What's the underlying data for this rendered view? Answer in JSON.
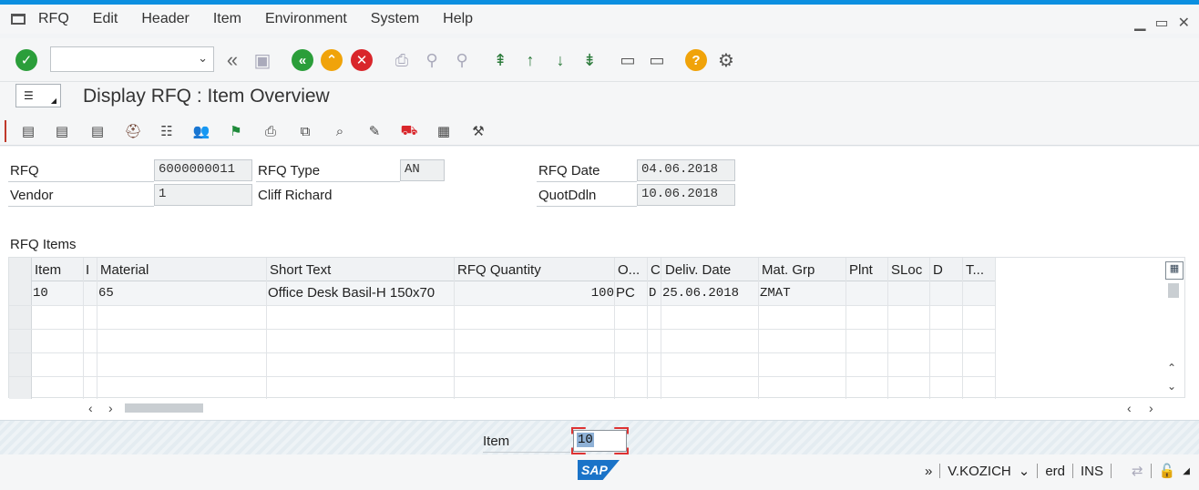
{
  "menu": {
    "items": [
      "RFQ",
      "Edit",
      "Header",
      "Item",
      "Environment",
      "System",
      "Help"
    ]
  },
  "window_controls": [
    "minimize-icon",
    "maximize-icon",
    "close-icon"
  ],
  "toolbar": {
    "command_field_value": "",
    "icons": [
      "enter-checkmark-icon",
      "back-double-chevron-icon",
      "save-icon",
      "back-icon",
      "exit-icon",
      "cancel-icon",
      "print-icon",
      "find-icon",
      "find-next-icon",
      "first-page-icon",
      "previous-page-icon",
      "next-page-icon",
      "last-page-icon",
      "create-session-icon",
      "shortcut-icon",
      "help-icon",
      "settings-gear-icon"
    ]
  },
  "title": {
    "text": "Display RFQ : Item Overview"
  },
  "app_toolbar": {
    "icons": [
      "item-details-icon",
      "header-details-icon",
      "texts-icon",
      "vendor-hat-icon",
      "structure-icon",
      "partners-icon",
      "flag-icon",
      "print-preview-icon",
      "components-icon",
      "conditions-icon",
      "additional-data-icon",
      "delivery-truck-icon",
      "schedule-calendar-icon",
      "services-icon"
    ]
  },
  "header": {
    "rfq_label": "RFQ",
    "rfq_value": "6000000011",
    "rfq_type_label": "RFQ Type",
    "rfq_type_value": "AN",
    "rfq_date_label": "RFQ Date",
    "rfq_date_value": "04.06.2018",
    "vendor_label": "Vendor",
    "vendor_value": "1",
    "vendor_name": "Cliff Richard",
    "quot_ddln_label": "QuotDdln",
    "quot_ddln_value": "10.06.2018"
  },
  "items_section": {
    "title": "RFQ Items",
    "columns": [
      "Item",
      "I",
      "Material",
      "Short Text",
      "RFQ Quantity",
      "O...",
      "C",
      "Deliv. Date",
      "Mat. Grp",
      "Plnt",
      "SLoc",
      "D",
      "T..."
    ],
    "rows": [
      [
        "10",
        "",
        "65",
        "Office Desk Basil-H 150x70",
        "100",
        "PC",
        "D",
        "25.06.2018",
        "ZMAT",
        "",
        "",
        "",
        ""
      ]
    ]
  },
  "item_entry": {
    "label": "Item",
    "value": "10"
  },
  "status": {
    "logo": "SAP",
    "user": "V.KOZICH",
    "client": "erd",
    "mode": "INS"
  }
}
